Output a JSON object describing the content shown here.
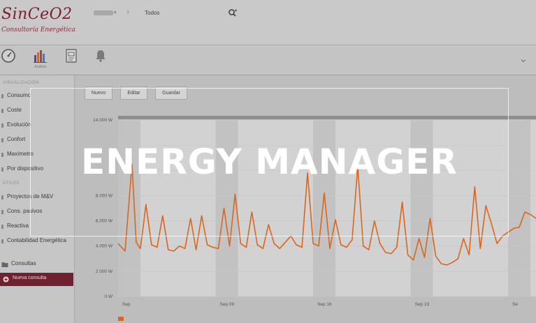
{
  "brand": {
    "name": "SinCeO2",
    "tagline": "Consultoría Energética",
    "colors": {
      "brand": "#7b1f2e",
      "accent": "#d9661e"
    }
  },
  "header": {
    "breadcrumb_root": "Todos",
    "icons": [
      "search-icon"
    ]
  },
  "toolbar": {
    "items": [
      {
        "icon": "dashboard-icon",
        "label": ""
      },
      {
        "icon": "bar-chart-icon",
        "label": "Análisis"
      },
      {
        "icon": "report-icon",
        "label": ""
      },
      {
        "icon": "bell-icon",
        "label": ""
      }
    ]
  },
  "sidebar": {
    "section_visualization": "VISUALIZACIÓN",
    "visualization_items": [
      "Consumo",
      "Coste",
      "Evolución",
      "Confort",
      "Maxímetro",
      "Por dispositivo"
    ],
    "section_tools": "ÚTILES",
    "tool_items": [
      "Proyectos de M&V",
      "Cons. pasivos",
      "Reactiva",
      "Contabilidad Energética"
    ],
    "consultas_label": "Consultas",
    "new_query_label": "Nueva consulta"
  },
  "actions": {
    "new_label": "Nuevo",
    "edit_label": "Editar",
    "save_label": "Guardar"
  },
  "overlay": {
    "title": "ENERGY MANAGER"
  },
  "chart_data": {
    "type": "line",
    "y_unit": "W",
    "ylim": [
      0,
      14000
    ],
    "y_ticks": [
      "0 W",
      "2.000 W",
      "4.000 W",
      "6.000 W",
      "8.000 W",
      "",
      "",
      "14.000 W"
    ],
    "x_ticks": [
      "Sep",
      "Sep 09",
      "Sep 16",
      "Sep 23",
      "Se"
    ],
    "x_range_days": [
      1,
      31
    ],
    "grid": true,
    "series": [
      {
        "color": "#d9661e",
        "x": [
          1,
          1.5,
          2,
          2.3,
          2.6,
          3,
          3.4,
          3.8,
          4.2,
          4.6,
          5,
          5.4,
          5.8,
          6.2,
          6.6,
          7,
          7.4,
          7.8,
          8.2,
          8.6,
          9,
          9.4,
          9.8,
          10.2,
          10.6,
          11,
          11.4,
          11.8,
          12.2,
          12.6,
          13,
          13.4,
          13.8,
          14.2,
          14.6,
          15,
          15.4,
          15.8,
          16.2,
          16.6,
          17,
          17.4,
          17.8,
          18.2,
          18.6,
          19,
          19.4,
          19.8,
          20.2,
          20.6,
          21,
          21.4,
          21.8,
          22.2,
          22.6,
          23,
          23.4,
          23.8,
          24.2,
          24.6,
          25,
          25.4,
          25.8,
          26.2,
          26.6,
          27,
          27.4,
          27.8,
          28.2,
          28.6,
          29,
          29.4,
          29.8,
          30.2,
          30.6,
          31
        ],
        "values": [
          4200,
          3600,
          10500,
          4300,
          3800,
          7300,
          4100,
          3900,
          6400,
          3700,
          3600,
          4000,
          3800,
          6200,
          3700,
          6400,
          4100,
          3900,
          3800,
          7000,
          4000,
          8100,
          4200,
          3900,
          6700,
          4100,
          3800,
          5700,
          4200,
          3800,
          4300,
          4800,
          4100,
          3900,
          9800,
          4200,
          4000,
          8200,
          3800,
          6100,
          4100,
          3900,
          4500,
          10300,
          4000,
          3700,
          6000,
          4200,
          3500,
          3400,
          3900,
          7500,
          3300,
          2900,
          4600,
          3100,
          6200,
          3200,
          2600,
          2500,
          2700,
          3000,
          4600,
          3300,
          8700,
          3800,
          7200,
          5800,
          4200,
          4800,
          5100,
          5400,
          5500,
          6700,
          6500,
          6200
        ]
      }
    ]
  }
}
